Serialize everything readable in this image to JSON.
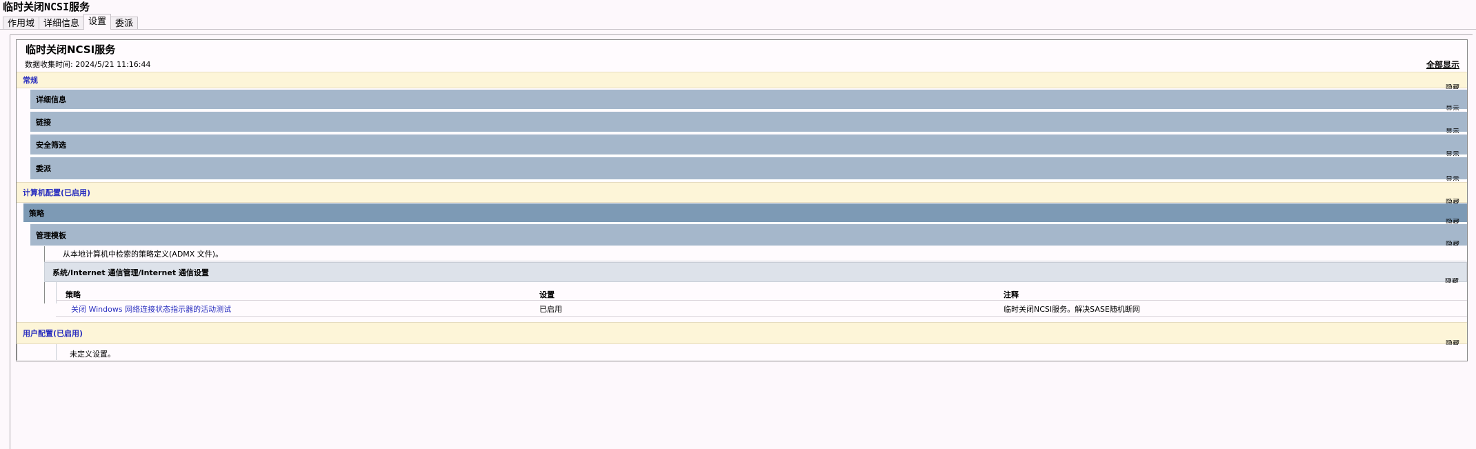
{
  "window": {
    "title": "临时关闭NCSI服务"
  },
  "tabs": [
    "作用域",
    "详细信息",
    "设置",
    "委派"
  ],
  "active_tab": 2,
  "report": {
    "title": "临时关闭NCSI服务",
    "collected": "数据收集时间: 2024/5/21 11:16:44",
    "show_all": "全部显示",
    "toggle_hide": "隐藏",
    "toggle_show": "显示",
    "general": {
      "label": "常规",
      "sections": [
        "详细信息",
        "链接",
        "安全筛选",
        "委派"
      ]
    },
    "computer": {
      "label": "计算机配置(已启用)",
      "policies_label": "策略",
      "admin_templates_label": "管理模板",
      "admx_note": "从本地计算机中检索的策略定义(ADMX 文件)。",
      "category": "系统/Internet 通信管理/Internet 通信设置",
      "table": {
        "headers": [
          "策略",
          "设置",
          "注释"
        ],
        "rows": [
          [
            "关闭 Windows 网络连接状态指示器的活动测试",
            "已启用",
            "临时关闭NCSI服务。解决SASE随机断网"
          ]
        ]
      }
    },
    "user": {
      "label": "用户配置(已启用)",
      "no_settings": "未定义设置。"
    }
  }
}
